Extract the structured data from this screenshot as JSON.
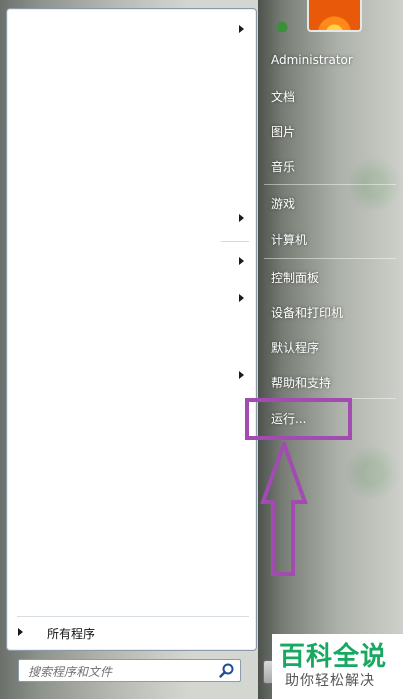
{
  "right_menu": {
    "user": "Administrator",
    "documents": "文档",
    "pictures": "图片",
    "music": "音乐",
    "games": "游戏",
    "computer": "计算机",
    "control_panel": "控制面板",
    "devices_printers": "设备和打印机",
    "default_programs": "默认程序",
    "help_support": "帮助和支持",
    "run": "运行..."
  },
  "left_panel": {
    "all_programs": "所有程序",
    "search_placeholder": "搜索程序和文件"
  },
  "watermark": {
    "title": "百科全说",
    "subtitle": "助你轻松解决"
  },
  "colors": {
    "annotation": "#a24bb0",
    "watermark_green": "#19a862"
  },
  "icons": [
    "submenu-arrow-icon",
    "search-icon",
    "user-avatar-flower",
    "annotation-arrow"
  ]
}
